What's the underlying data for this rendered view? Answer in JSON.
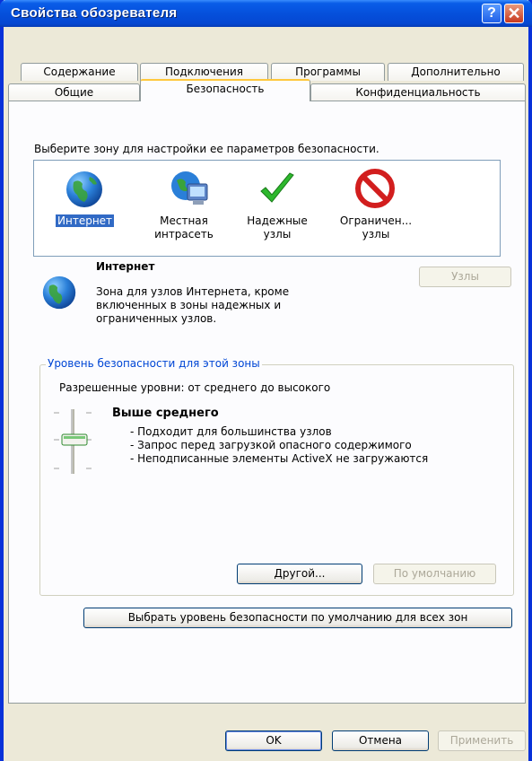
{
  "window": {
    "title": "Свойства обозревателя",
    "help_glyph": "?",
    "close_glyph": "✕"
  },
  "tabs": {
    "row_back": [
      "Содержание",
      "Подключения",
      "Программы",
      "Дополнительно"
    ],
    "row_front": [
      "Общие",
      "Безопасность",
      "Конфиденциальность"
    ]
  },
  "zones": {
    "prompt": "Выберите зону для настройки ее параметров безопасности.",
    "items": [
      {
        "line1": "Интернет",
        "line2": "",
        "icon": "globe-icon"
      },
      {
        "line1": "Местная",
        "line2": "интрасеть",
        "icon": "intranet-icon"
      },
      {
        "line1": "Надежные",
        "line2": "узлы",
        "icon": "checkmark-icon"
      },
      {
        "line1": "Ограничен...",
        "line2": "узлы",
        "icon": "restricted-icon"
      }
    ]
  },
  "zone_info": {
    "title": "Интернет",
    "description": [
      "Зона для узлов Интернета, кроме",
      "включенных в зоны надежных и",
      "ограниченных узлов."
    ],
    "sites_button": "Узлы"
  },
  "security_level": {
    "legend": "Уровень безопасности для этой зоны",
    "allowed": "Разрешенные уровни: от среднего до высокого",
    "level_name": "Выше среднего",
    "bullets": [
      "- Подходит для большинства узлов",
      "- Запрос перед загрузкой опасного содержимого",
      "- Неподписанные элементы ActiveX не загружаются"
    ],
    "custom_button": "Другой...",
    "default_button": "По умолчанию",
    "reset_all_button": "Выбрать уровень безопасности по умолчанию для всех зон"
  },
  "footer": {
    "ok": "OK",
    "cancel": "Отмена",
    "apply": "Применить"
  },
  "colors": {
    "title_bar": "#0550dc",
    "selection": "#316ac5",
    "legend_text": "#0046d5",
    "face": "#ece9d8"
  }
}
